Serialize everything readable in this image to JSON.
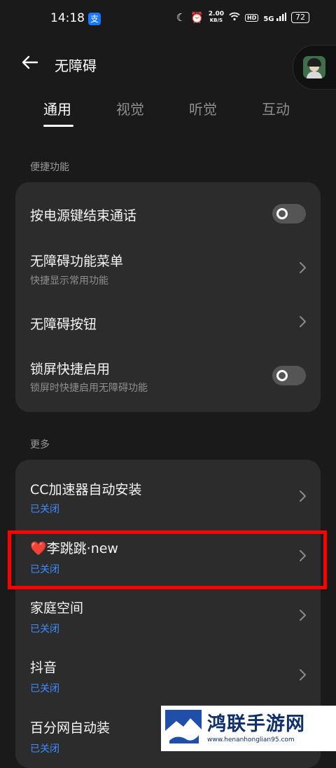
{
  "status_bar": {
    "time": "14:18",
    "alipay_glyph": "支",
    "net_speed_value": "2.00",
    "net_speed_unit": "KB/S",
    "hd": "HD",
    "signal_gen": "5G",
    "battery": "72"
  },
  "header": {
    "title": "无障碍"
  },
  "tabs": [
    {
      "label": "通用",
      "active": true
    },
    {
      "label": "视觉",
      "active": false
    },
    {
      "label": "听觉",
      "active": false
    },
    {
      "label": "互动",
      "active": false
    }
  ],
  "sections": {
    "shortcuts": {
      "label": "便捷功能",
      "items": [
        {
          "title": "按电源键结束通话",
          "control": "toggle",
          "on": false
        },
        {
          "title": "无障碍功能菜单",
          "subtitle": "快捷显示常用功能",
          "control": "chevron"
        },
        {
          "title": "无障碍按钮",
          "control": "chevron"
        },
        {
          "title": "锁屏快捷启用",
          "subtitle": "锁屏时快捷启用无障碍功能",
          "control": "toggle",
          "on": false
        }
      ]
    },
    "more": {
      "label": "更多",
      "items": [
        {
          "title": "CC加速器自动安装",
          "subtitle": "已关闭",
          "control": "chevron"
        },
        {
          "title": "❤️李跳跳·new",
          "subtitle": "已关闭",
          "control": "chevron"
        },
        {
          "title": "家庭空间",
          "subtitle": "已关闭",
          "control": "chevron"
        },
        {
          "title": "抖音",
          "subtitle": "已关闭",
          "control": "chevron"
        },
        {
          "title": "百分网自动装",
          "subtitle": "已关闭",
          "control": "chevron"
        }
      ]
    }
  },
  "watermark": {
    "text": "鸿联手游网",
    "url": "www.henanhonglian95.com"
  },
  "colors": {
    "background": "#1a1a1a",
    "card": "#2c2c2c",
    "status_blue": "#3f8cff",
    "highlight": "#ff0000"
  }
}
